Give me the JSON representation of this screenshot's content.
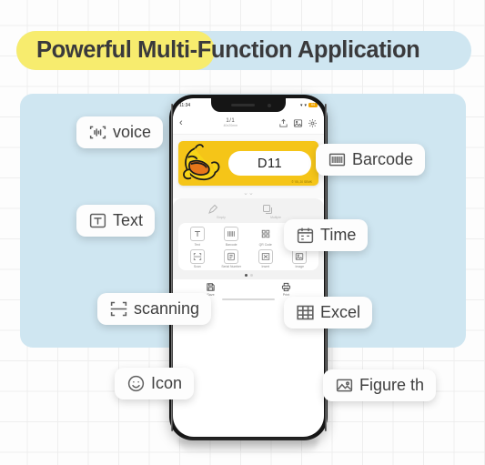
{
  "header": {
    "title": "Powerful Multi-Function Application",
    "highlight_yellow": "#f7ec6e",
    "highlight_blue": "#cfe6f1"
  },
  "panel": {
    "background": "#cfe6f1"
  },
  "phone": {
    "status_bar": {
      "time": "11:34",
      "wifi": "wifi-icon",
      "signal": "signal-icon",
      "battery": "64"
    },
    "nav_bar": {
      "back": "‹",
      "title": "1/1",
      "subtitle": "40x20mm",
      "icons": [
        "share-icon",
        "image-icon",
        "gear-icon"
      ]
    },
    "label_preview": {
      "text": "D11",
      "background": "#f5c518",
      "copyright": "© '05, 20 SEMK",
      "mascot": "duck-illustration"
    },
    "collapse_handle": "chevron-double-down-icon",
    "quick_actions": [
      {
        "icon": "empty-icon",
        "label": "Empty"
      },
      {
        "icon": "multiple-icon",
        "label": "Multiple"
      }
    ],
    "tool_grid": [
      {
        "icon": "text-icon",
        "label": "Text"
      },
      {
        "icon": "barcode-icon",
        "label": "Barcode"
      },
      {
        "icon": "qrcode-icon",
        "label": "QR Code"
      },
      {
        "icon": "table-icon",
        "label": "Table"
      },
      {
        "icon": "scan-icon",
        "label": "Scan"
      },
      {
        "icon": "serial-number-icon",
        "label": "Serial Number"
      },
      {
        "icon": "insert-icon",
        "label": "Insert"
      },
      {
        "icon": "image-icon",
        "label": "Image"
      }
    ],
    "page_dots": {
      "total": 2,
      "active": 1
    },
    "bottom_bar": [
      {
        "icon": "save-icon",
        "label": "Save"
      },
      {
        "icon": "print-icon",
        "label": "Print"
      }
    ]
  },
  "callouts": [
    {
      "key": "voice",
      "icon": "voice-waveform-icon",
      "label": "voice"
    },
    {
      "key": "barcode",
      "icon": "barcode-icon",
      "label": "Barcode"
    },
    {
      "key": "text",
      "icon": "text-t-icon",
      "label": "Text"
    },
    {
      "key": "time",
      "icon": "calendar-icon",
      "label": "Time"
    },
    {
      "key": "scan",
      "icon": "scan-frame-icon",
      "label": "scanning"
    },
    {
      "key": "excel",
      "icon": "table-grid-icon",
      "label": "Excel"
    },
    {
      "key": "icon",
      "icon": "smiley-face-icon",
      "label": "Icon"
    },
    {
      "key": "figure",
      "icon": "picture-icon",
      "label": "Figure th"
    }
  ]
}
